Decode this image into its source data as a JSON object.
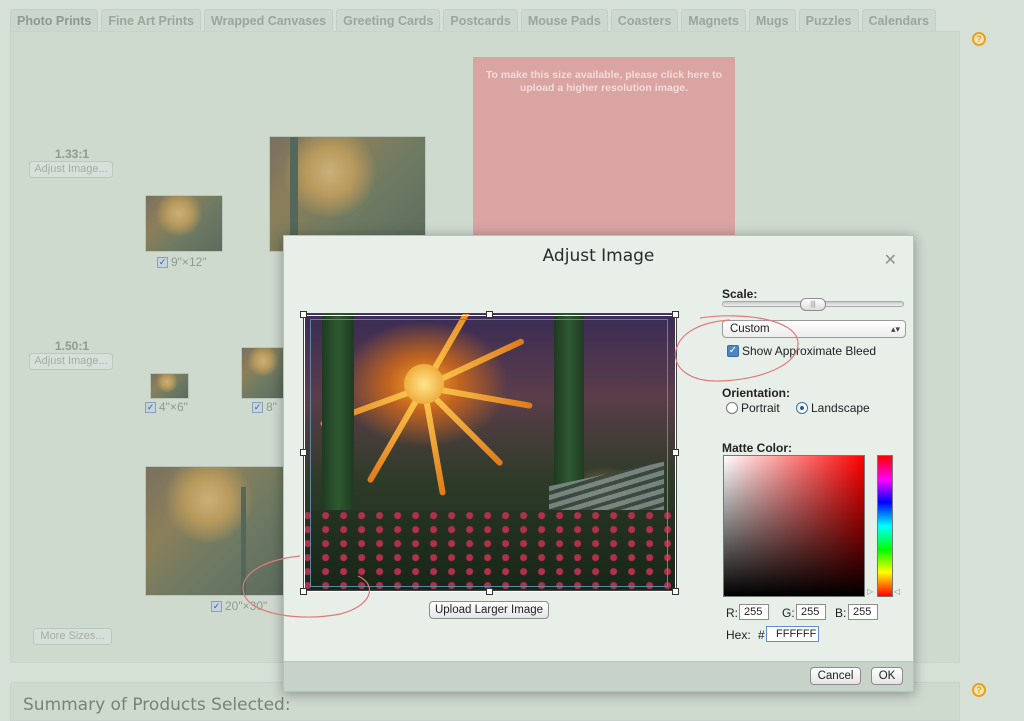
{
  "tabs": [
    "Photo Prints",
    "Fine Art Prints",
    "Wrapped Canvases",
    "Greeting Cards",
    "Postcards",
    "Mouse Pads",
    "Coasters",
    "Magnets",
    "Mugs",
    "Puzzles",
    "Calendars"
  ],
  "background": {
    "ratio_1": "1.33:1",
    "ratio_2": "1.50:1",
    "adjust_button": "Adjust Image...",
    "sizes": [
      "9\"×12\"",
      "4\"×6\"",
      "8\"",
      "20\"×30\""
    ],
    "unavailable_message": "To make this size available, please click here to upload a higher resolution image.",
    "more_sizes": "More Sizes...",
    "summary_title": "Summary of Products Selected:"
  },
  "modal": {
    "title": "Adjust Image",
    "upload_button": "Upload Larger Image",
    "scale_label": "Scale:",
    "scale_value": 0.5,
    "scale_select": "Custom",
    "bleed_checkbox": "Show Approximate Bleed",
    "bleed_checked": true,
    "orientation_label": "Orientation:",
    "orientation_options": [
      "Portrait",
      "Landscape"
    ],
    "orientation_selected": "Landscape",
    "matte_label": "Matte Color:",
    "r_label": "R:",
    "g_label": "G:",
    "b_label": "B:",
    "r": "255",
    "g": "255",
    "b": "255",
    "hex_label": "Hex:",
    "hex_prefix": "#",
    "hex": "FFFFFF",
    "cancel": "Cancel",
    "ok": "OK"
  },
  "colors": {
    "accent": "#4d86c2",
    "help": "#e5a21c",
    "annotation": "#e07a7a"
  }
}
